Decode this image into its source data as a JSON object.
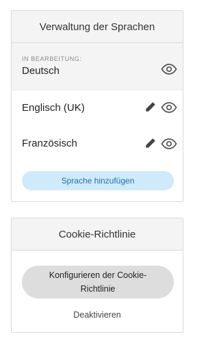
{
  "languages_panel": {
    "title": "Verwaltung der Sprachen",
    "editing_caption": "IN BEARBEITUNG:",
    "editing_language": "Deutsch",
    "languages": [
      {
        "label": "Englisch (UK)"
      },
      {
        "label": "Französisch"
      }
    ],
    "add_button": "Sprache hinzufügen"
  },
  "cookie_panel": {
    "title": "Cookie-Richtlinie",
    "configure_button": "Konfigurieren der Cookie-Richtlinie",
    "deactivate_link": "Deaktivieren"
  },
  "icons": {
    "eye": "eye-icon",
    "pencil": "pencil-icon"
  },
  "colors": {
    "add_button_bg": "#cfeafb",
    "add_button_text": "#1f6fa8",
    "config_button_bg": "#dddddd",
    "header_bg": "#f4f4f4"
  }
}
